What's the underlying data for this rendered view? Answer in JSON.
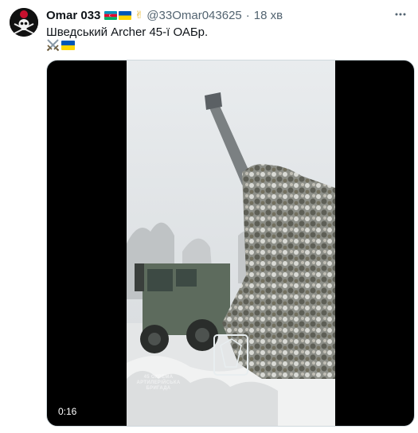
{
  "tweet": {
    "author_name": "Omar 033",
    "author_handle": "@33Omar043625",
    "separator": "·",
    "time": "18 хв",
    "text": "Шведський Archer 45-ї ОАБр.",
    "emoji_line": [
      "crossed-swords",
      "ukraine-flag"
    ],
    "name_badges": [
      "azerbaijan-flag",
      "ukraine-flag",
      "hand-icon"
    ]
  },
  "media": {
    "type": "video",
    "duration": "0:16",
    "watermark": "45 ОКРЕМА АРТИЛЕРІЙСЬКА БРИГАДА"
  },
  "colors": {
    "text_primary": "#0f1419",
    "text_secondary": "#536471",
    "media_border": "#cfd9de"
  }
}
